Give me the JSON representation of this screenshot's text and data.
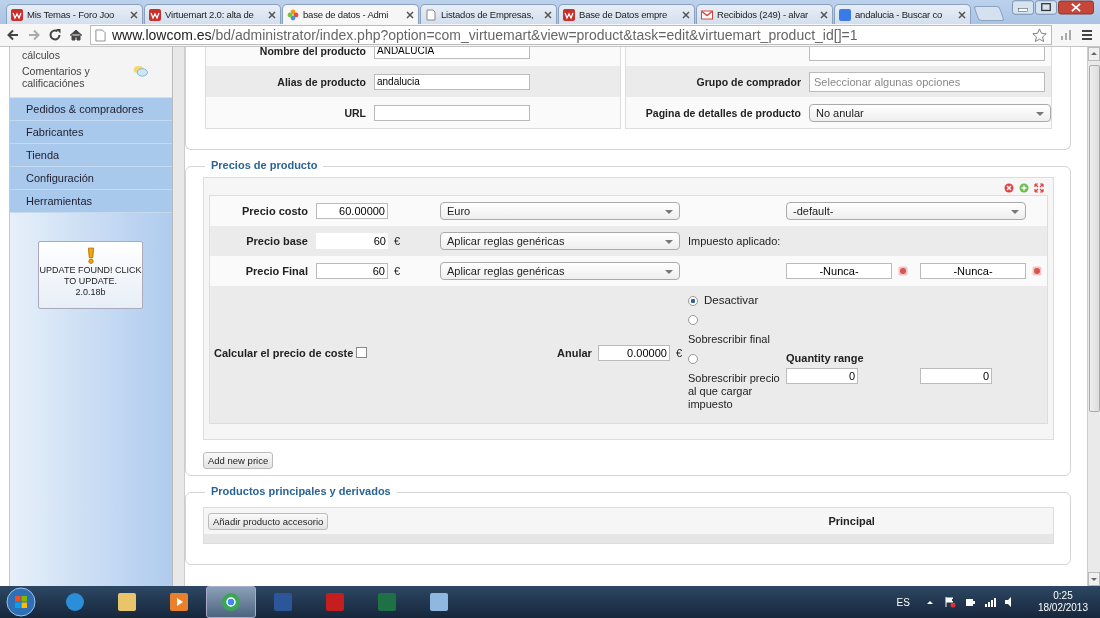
{
  "browser": {
    "tabs": [
      {
        "label": "Mis Temas - Foro Joo",
        "kind": "w",
        "selected": false
      },
      {
        "label": "Virtuemart 2.0: alta de",
        "kind": "w",
        "selected": false
      },
      {
        "label": "base de datos - Admi",
        "kind": "joomla",
        "selected": true
      },
      {
        "label": "Listados de Empresas,",
        "kind": "page",
        "selected": false
      },
      {
        "label": "Base de Datos empre",
        "kind": "w",
        "selected": false
      },
      {
        "label": "Recibidos (249) - alvar",
        "kind": "mail",
        "selected": false
      },
      {
        "label": "andalucia - Buscar co",
        "kind": "search",
        "selected": false
      }
    ],
    "url_host": "www.lowcom.es",
    "url_path": "/bd/administrator/index.php?option=com_virtuemart&view=product&task=edit&virtuemart_product_id[]=1"
  },
  "sidebar": {
    "submenu": [
      {
        "label": "cálculos"
      },
      {
        "label": "Comentarios y calificaciónes",
        "icon": true
      }
    ],
    "menu": [
      {
        "label": "Pedidos & compradores"
      },
      {
        "label": "Fabricantes"
      },
      {
        "label": "Tienda"
      },
      {
        "label": "Configuración"
      },
      {
        "label": "Herramientas"
      }
    ],
    "update_notice": {
      "text": "UPDATE FOUND! CLICK TO UPDATE.",
      "version": "2.0.18b"
    }
  },
  "product_info": {
    "left": [
      {
        "label": "Nombre del producto",
        "value": "ANDALUCIA"
      },
      {
        "label": "Alias de producto",
        "value": "andalucia"
      },
      {
        "label": "URL"
      }
    ],
    "right": [
      {
        "kind": "input"
      },
      {
        "label": "Grupo de comprador",
        "kind": "multiselect",
        "placeholder": "Seleccionar algunas opciones"
      },
      {
        "label": "Pagina de detalles de producto",
        "kind": "select",
        "value": "No anular"
      }
    ]
  },
  "prices": {
    "title": "Precios de producto",
    "cost": {
      "label": "Precio costo",
      "value": "60.00000",
      "currency": "Euro",
      "shopper_group": "-default-"
    },
    "base": {
      "label": "Precio base",
      "value": "60",
      "currency_symbol": "€",
      "rule": "Aplicar reglas genéricas",
      "tax_label": "Impuesto aplicado:"
    },
    "final": {
      "label": "Precio Final",
      "value": "60",
      "currency_symbol": "€",
      "rule": "Aplicar reglas genéricas",
      "date_from": "-Nunca-",
      "date_to": "-Nunca-"
    },
    "calc_cost": {
      "label": "Calcular el precio de coste",
      "checked": false
    },
    "override": {
      "label": "Anular",
      "value": "0.00000",
      "currency_symbol": "€"
    },
    "override_options": [
      {
        "label": "Desactivar",
        "kind": "inline",
        "selected": true
      },
      {
        "label": "Sobrescribir final",
        "kind": "below",
        "selected": false
      },
      {
        "label": "Sobrescribir precio al que cargar impuesto",
        "kind": "below",
        "selected": false
      }
    ],
    "quantity": {
      "label": "Quantity range",
      "from": "0",
      "to": "0"
    },
    "add_button": "Add new price"
  },
  "related": {
    "title": "Productos principales y derivados",
    "add_button": "Añadir producto accesorio",
    "column": "Principal"
  },
  "taskbar": {
    "apps": [
      {
        "kind": "ie",
        "selected": false
      },
      {
        "kind": "folder",
        "selected": false
      },
      {
        "kind": "media",
        "selected": false
      },
      {
        "kind": "chrome",
        "selected": true
      },
      {
        "kind": "word",
        "selected": false
      },
      {
        "kind": "ftp",
        "selected": false
      },
      {
        "kind": "excel",
        "selected": false
      },
      {
        "kind": "note",
        "selected": false
      }
    ],
    "language": "ES",
    "time": "0:25",
    "date": "18/02/2013"
  }
}
